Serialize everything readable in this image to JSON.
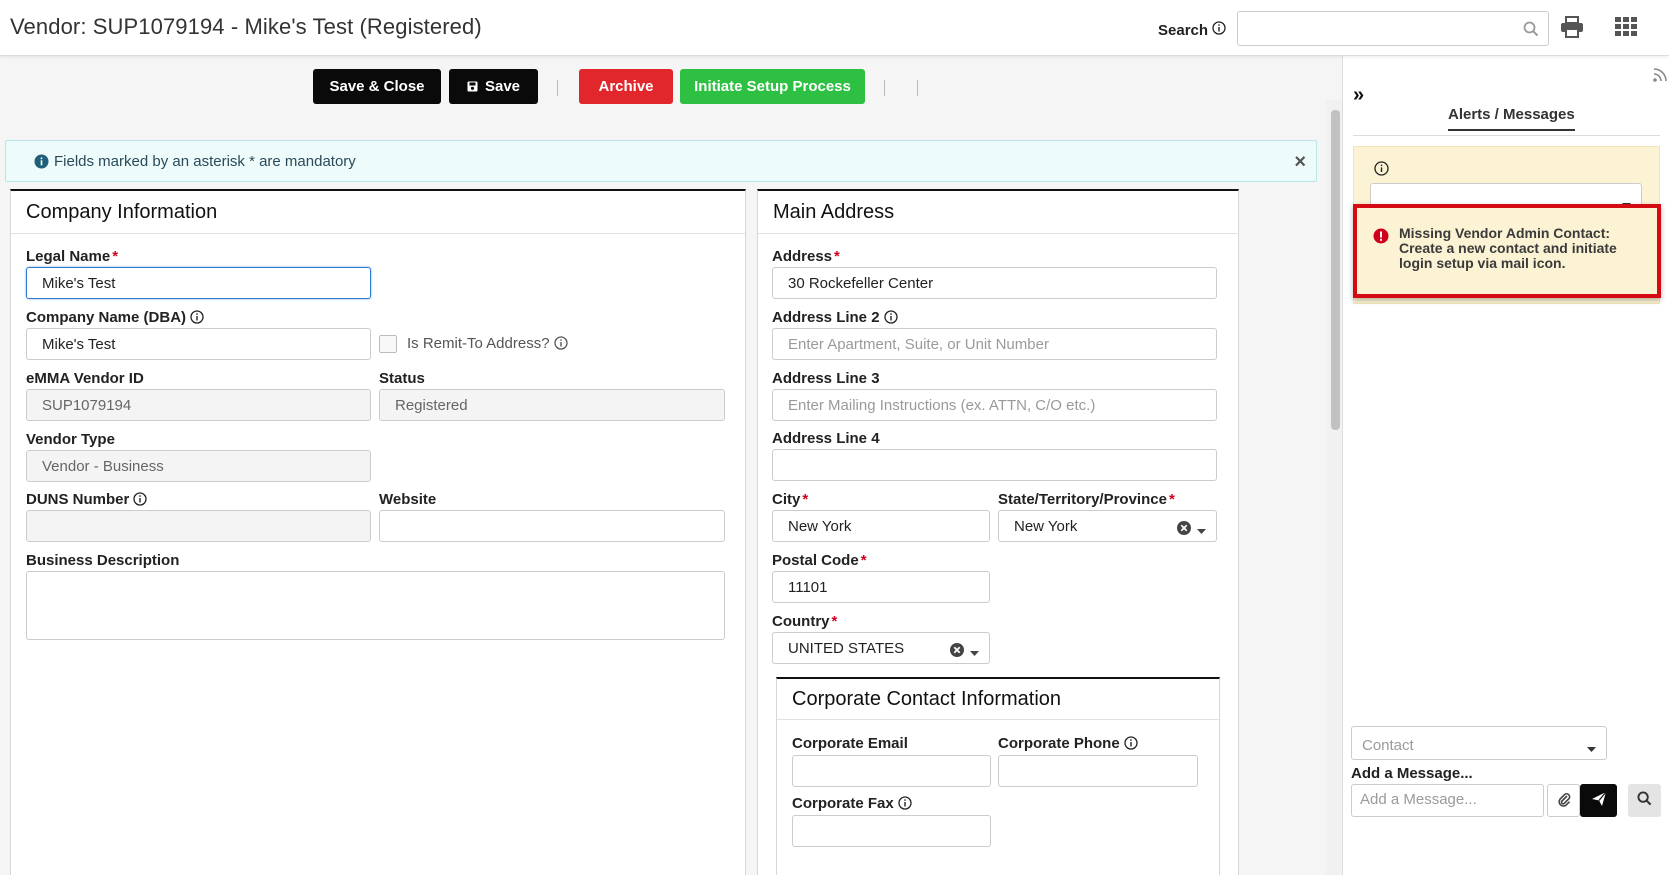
{
  "header": {
    "title": "Vendor: SUP1079194 - Mike's Test (Registered)",
    "search_label": "Search",
    "search_value": ""
  },
  "toolbar": {
    "save_close_label": "Save & Close",
    "save_label": "Save",
    "archive_label": "Archive",
    "initiate_label": "Initiate Setup Process",
    "colors": {
      "dark": "#0a0a0a",
      "archive": "#e1262c",
      "initiate": "#2ec043"
    }
  },
  "notice": {
    "text": "Fields marked by an asterisk * are mandatory",
    "close": "×"
  },
  "company": {
    "title": "Company Information",
    "legal_name_label": "Legal Name",
    "legal_name_value": "Mike's Test",
    "dba_label": "Company Name (DBA)",
    "dba_value": "Mike's Test",
    "remit_label": "Is Remit-To Address?",
    "vendor_id_label": "eMMA Vendor ID",
    "vendor_id_value": "SUP1079194",
    "status_label": "Status",
    "status_value": "Registered",
    "vendor_type_label": "Vendor Type",
    "vendor_type_value": "Vendor - Business",
    "duns_label": "DUNS Number",
    "duns_value": "",
    "website_label": "Website",
    "website_value": "",
    "business_desc_label": "Business Description",
    "business_desc_value": ""
  },
  "address": {
    "title": "Main Address",
    "address_label": "Address",
    "address_value": "30 Rockefeller Center",
    "line2_label": "Address Line 2",
    "line2_placeholder": "Enter Apartment, Suite, or Unit Number",
    "line3_label": "Address Line 3",
    "line3_placeholder": "Enter Mailing Instructions (ex. ATTN, C/O etc.)",
    "line4_label": "Address Line 4",
    "line4_value": "",
    "city_label": "City",
    "city_value": "New York",
    "state_label": "State/Territory/Province",
    "state_value": "New York",
    "postal_label": "Postal Code",
    "postal_value": "11101",
    "country_label": "Country",
    "country_value": "UNITED STATES"
  },
  "corporate": {
    "title": "Corporate Contact Information",
    "email_label": "Corporate Email",
    "phone_label": "Corporate Phone",
    "fax_label": "Corporate Fax"
  },
  "side": {
    "tab_label": "Alerts / Messages",
    "alert_message": "Missing Vendor Admin Contact: Create a new contact and initiate login setup via mail icon.",
    "contact_placeholder": "Contact",
    "add_message_label": "Add a Message...",
    "message_placeholder": "Add a Message...",
    "colors": {
      "panel": "#fcf3d5",
      "highlight": "#d60a12"
    }
  }
}
